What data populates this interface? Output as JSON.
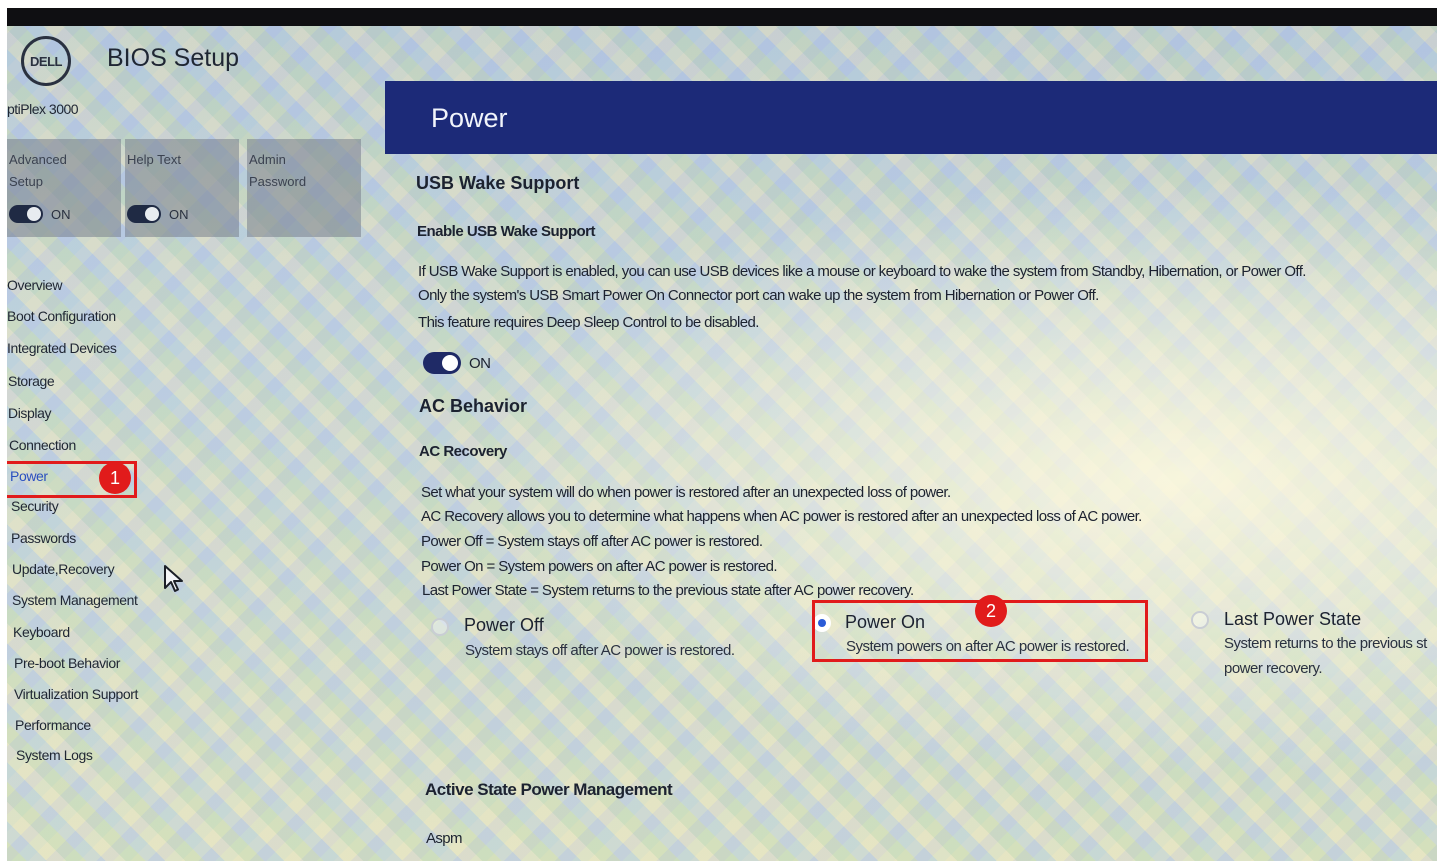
{
  "app": {
    "logo_text": "DELL",
    "title": "BIOS Setup",
    "model": "ptiPlex 3000"
  },
  "tiles": [
    {
      "label_line1": "Advanced",
      "label_line2": "Setup",
      "toggle_label": "ON"
    },
    {
      "label_line1": "Help Text",
      "label_line2": "",
      "toggle_label": "ON"
    },
    {
      "label_line1": "Admin",
      "label_line2": "Password"
    }
  ],
  "nav": [
    {
      "label": "Overview"
    },
    {
      "label": "Boot Configuration"
    },
    {
      "label": "Integrated Devices"
    },
    {
      "label": "Storage"
    },
    {
      "label": "Display"
    },
    {
      "label": "Connection"
    },
    {
      "label": "Power"
    },
    {
      "label": "Security"
    },
    {
      "label": "Passwords"
    },
    {
      "label": "Update,Recovery"
    },
    {
      "label": "System Management"
    },
    {
      "label": "Keyboard"
    },
    {
      "label": "Pre-boot Behavior"
    },
    {
      "label": "Virtualization Support"
    },
    {
      "label": "Performance"
    },
    {
      "label": "System Logs"
    }
  ],
  "page": {
    "title": "Power",
    "usb_wake": {
      "heading": "USB Wake Support",
      "subheading": "Enable USB Wake Support",
      "desc_lines": [
        "If USB Wake Support is enabled, you can use USB devices like a mouse or keyboard to wake the system from Standby, Hibernation, or Power Off.",
        "Only the system's USB Smart Power On Connector port can wake up the system from Hibernation or Power Off.",
        "This feature requires Deep Sleep Control to be disabled."
      ],
      "toggle_label": "ON"
    },
    "ac_behavior": {
      "heading": "AC Behavior",
      "subheading": "AC Recovery",
      "desc_lines": [
        "Set what your system will do when power is restored after an unexpected loss of power.",
        "AC Recovery allows you to determine what happens when AC power is restored after an unexpected loss of AC power.",
        "Power Off = System stays off after AC power is restored.",
        "Power On = System powers on after AC power is restored.",
        "Last Power State = System returns to the previous state after AC power recovery."
      ],
      "options": [
        {
          "title": "Power Off",
          "desc": "System stays off after AC power is restored.",
          "desc2": ""
        },
        {
          "title": "Power On",
          "desc": "System powers on after AC power is restored.",
          "desc2": ""
        },
        {
          "title": "Last Power State",
          "desc": "System returns to the previous st",
          "desc2": "power recovery."
        }
      ],
      "selected_option": "Power On"
    },
    "aspm": {
      "heading": "Active State Power Management",
      "subheading": "Aspm"
    }
  },
  "annotations": [
    {
      "number": "1"
    },
    {
      "number": "2"
    }
  ],
  "colors": {
    "title_bar": "#1c2a78",
    "highlight": "#e11b1b",
    "active_nav": "#2a4fbf",
    "toggle": "#1f2a66"
  },
  "icons": {
    "cursor": "mouse-pointer-icon",
    "logo": "dell-logo-icon"
  }
}
